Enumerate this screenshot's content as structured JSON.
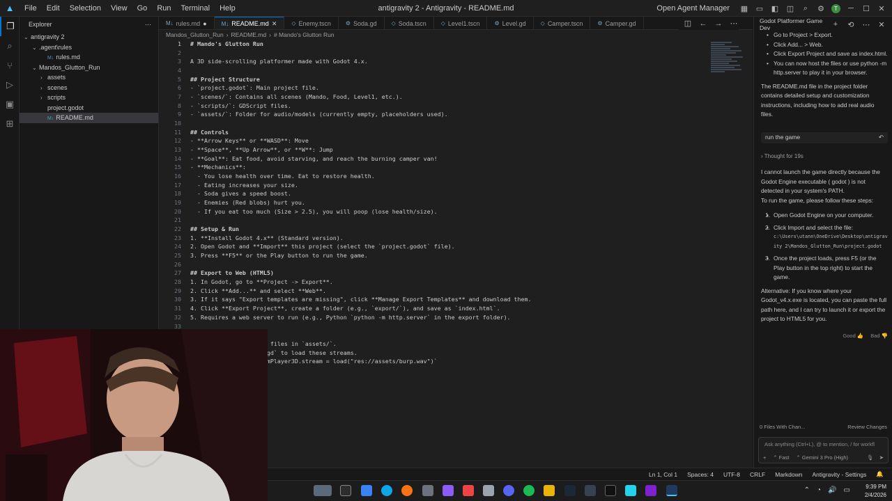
{
  "window": {
    "title": "antigravity 2 - Antigravity - README.md",
    "menu": [
      "File",
      "Edit",
      "Selection",
      "View",
      "Go",
      "Run",
      "Terminal",
      "Help"
    ],
    "open_agent_manager": "Open Agent Manager"
  },
  "explorer": {
    "title": "Explorer",
    "items": [
      {
        "label": "antigravity 2",
        "depth": 0,
        "kind": "folder-open"
      },
      {
        "label": ".agent\\rules",
        "depth": 1,
        "kind": "folder-open"
      },
      {
        "label": "rules.md",
        "depth": 2,
        "kind": "md"
      },
      {
        "label": "Mandos_Glutton_Run",
        "depth": 1,
        "kind": "folder-open"
      },
      {
        "label": "assets",
        "depth": 2,
        "kind": "folder"
      },
      {
        "label": "scenes",
        "depth": 2,
        "kind": "folder"
      },
      {
        "label": "scripts",
        "depth": 2,
        "kind": "folder"
      },
      {
        "label": "project.godot",
        "depth": 2,
        "kind": "file"
      },
      {
        "label": "README.md",
        "depth": 2,
        "kind": "md",
        "selected": true
      }
    ]
  },
  "tabs": [
    {
      "label": "rules.md",
      "modified": true
    },
    {
      "label": "README.md",
      "active": true
    },
    {
      "label": "Enemy.tscn"
    },
    {
      "label": "Soda.gd"
    },
    {
      "label": "Soda.tscn"
    },
    {
      "label": "Level1.tscn"
    },
    {
      "label": "Level.gd"
    },
    {
      "label": "Camper.tscn"
    },
    {
      "label": "Camper.gd"
    }
  ],
  "breadcrumb": [
    "Mandos_Glutton_Run",
    "README.md",
    "# Mando's Glutton Run"
  ],
  "code_lines": [
    "# Mando's Glutton Run",
    "",
    "A 3D side-scrolling platformer made with Godot 4.x.",
    "",
    "## Project Structure",
    "- `project.godot`: Main project file.",
    "- `scenes/`: Contains all scenes (Mando, Food, Level1, etc.).",
    "- `scripts/`: GDScript files.",
    "- `assets/`: Folder for audio/models (currently empty, placeholders used).",
    "",
    "## Controls",
    "- **Arrow Keys** or **WASD**: Move",
    "- **Space**, **Up Arrow**, or **W**: Jump",
    "- **Goal**: Eat food, avoid starving, and reach the burning camper van!",
    "- **Mechanics**:",
    "  - You lose health over time. Eat to restore health.",
    "  - Eating increases your size.",
    "  - Soda gives a speed boost.",
    "  - Enemies (Red blobs) hurt you.",
    "  - If you eat too much (Size > 2.5), you will poop (lose health/size).",
    "",
    "## Setup & Run",
    "1. **Install Godot 4.x** (Standard version).",
    "2. Open Godot and **Import** this project (select the `project.godot` file).",
    "3. Press **F5** or the Play button to run the game.",
    "",
    "## Export to Web (HTML5)",
    "1. In Godot, go to **Project -> Export**.",
    "2. Click **Add...** and select **Web**.",
    "3. If it says \"Export templates are missing\", click **Manage Export Templates** and download them.",
    "4. Click **Export Project**, create a folder (e.g., `export/`), and save as `index.html`.",
    "5. Requires a web server to run (e.g., Python `python -m http.server` in the export folder).",
    "",
    "",
    "                 .ogg` files in `assets/`.",
    "                 Food.gd` to load these streams.",
    "                 StreamPlayer3D.stream = load(\"res://assets/burp.wav\")`"
  ],
  "agent_panel": {
    "title": "Godot Platformer Game Dev",
    "top_bullets": [
      "Go to Project > Export.",
      "Click Add... > Web.",
      "Click Export Project and save as index.html.",
      "You can now host the files or use python -m http.server to play it in your browser."
    ],
    "readme_note": "The README.md file in the project folder contains detailed setup and customization instructions, including how to add real audio files.",
    "user_message": "run the game",
    "thought": "Thought for 19s",
    "answer_intro": "I cannot launch the game directly because the Godot Engine executable ( godot ) is not detected in your system's PATH.",
    "answer_intro2": "To run the game, please follow these steps:",
    "steps": [
      "Open Godot Engine on your computer.",
      "Click Import and select the file:",
      "Once the project loads, press F5 (or the Play button in the top right) to start the game."
    ],
    "step2_path": "c:\\Users\\utann\\OneDrive\\Desktop\\antigravity 2\\Mandos_Glutton_Run\\project.godot",
    "alternative": "Alternative: If you know where your Godot_v4.x.exe is located, you can paste the full path here, and I can try to launch it or export the project to HTML5 for you.",
    "good": "Good",
    "bad": "Bad",
    "files_changed": "0 Files With Chan...",
    "review_changes": "Review Changes",
    "chat_placeholder": "Ask anything (Ctrl+L), @ to mention, / for workfl",
    "mode": "Fast",
    "model": "Gemini 3 Pro (High)"
  },
  "statusbar": {
    "position": "Ln 1, Col 1",
    "spaces": "Spaces: 4",
    "encoding": "UTF-8",
    "eol": "CRLF",
    "language": "Markdown",
    "settings": "Antigravity - Settings"
  },
  "clock": {
    "time": "9:39 PM",
    "date": "2/4/2026"
  },
  "colors": {
    "accent": "#0078d4",
    "heading": "#569cd6"
  }
}
